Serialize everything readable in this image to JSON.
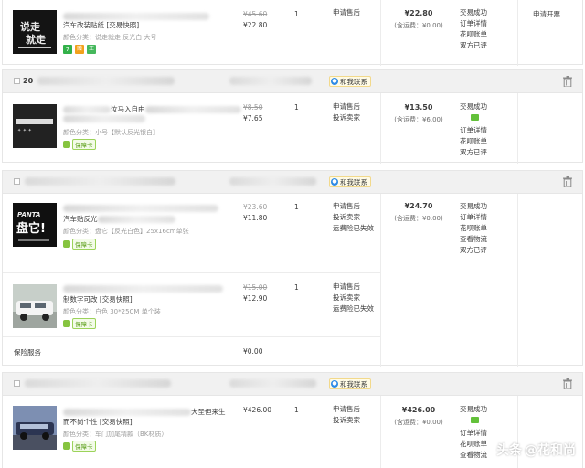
{
  "orders": [
    {
      "header": null,
      "items": [
        {
          "title_prefix": "",
          "title_visible": "汽车改装贴纸 [交易快照]",
          "spec": "颜色分类：说走就走 反光白 大号",
          "badges": [
            "7",
            "赠",
            "正"
          ],
          "orig_price": "¥45.60",
          "price": "¥22.80",
          "qty": "1",
          "services": [
            "申请售后"
          ]
        }
      ],
      "pay": {
        "amount": "¥22.80",
        "shipping": "(含运费：¥0.00)"
      },
      "status": [
        "交易成功",
        "订单详情",
        "花呗账单",
        "双方已评"
      ],
      "op": "申请开票"
    },
    {
      "header": {
        "order_no": "20",
        "contact": "和我联系"
      },
      "items": [
        {
          "title_visible": "汝马入自由",
          "spec": "颜色分类：小号【默认反光银白】",
          "card": "保障卡",
          "orig_price": "¥8.50",
          "price": "¥7.65",
          "qty": "1",
          "services": [
            "申请售后",
            "投诉卖家"
          ]
        }
      ],
      "pay": {
        "amount": "¥13.50",
        "shipping": "(含运费：¥6.00)"
      },
      "status": [
        "交易成功",
        "",
        "订单详情",
        "花呗账单",
        "双方已评"
      ]
    },
    {
      "header": {
        "contact": "和我联系"
      },
      "items": [
        {
          "title_visible": "汽车贴反光",
          "spec": "颜色分类：盘它【反光白色】25x16cm单张",
          "card": "保障卡",
          "orig_price": "¥23.60",
          "price": "¥11.80",
          "qty": "1",
          "services": [
            "申请售后",
            "投诉卖家",
            "运费险已失效"
          ]
        },
        {
          "title_visible": "制数字可改 [交易快照]",
          "spec": "颜色分类：白色 30*25CM 单个装",
          "card": "保障卡",
          "orig_price": "¥15.00",
          "price": "¥12.90",
          "qty": "1",
          "services": [
            "申请售后",
            "投诉卖家",
            "运费险已失效"
          ]
        }
      ],
      "insurance": {
        "label": "保险服务",
        "price": "¥0.00"
      },
      "pay": {
        "amount": "¥24.70",
        "shipping": "(含运费：¥0.00)"
      },
      "status": [
        "交易成功",
        "订单详情",
        "花呗账单",
        "查看物流",
        "双方已评"
      ]
    },
    {
      "header": {
        "contact": "和我联系"
      },
      "items": [
        {
          "title_visible": "大圣但来生",
          "title_line2": "而不尚个性 [交易快照]",
          "spec": "颜色分类：车门加尾精款（BK材质）",
          "card": "保障卡",
          "orig_price": "",
          "price": "¥426.00",
          "qty": "1",
          "services": [
            "申请售后",
            "投诉卖家"
          ]
        }
      ],
      "pay": {
        "amount": "¥426.00",
        "shipping": "(含运费：¥0.00)"
      },
      "status": [
        "交易成功",
        "",
        "订单详情",
        "花呗账单",
        "查看物流"
      ]
    }
  ],
  "thumb_text": {
    "t1": "说走就走",
    "t2": "PANTA",
    "t3": "盘它!"
  },
  "watermark": {
    "logo": "头条",
    "handle": "@花和尚"
  },
  "colors": {
    "accent_green": "#63c13a",
    "contact_blue": "#2d8ae6",
    "header_bg": "#f1f1f1"
  }
}
